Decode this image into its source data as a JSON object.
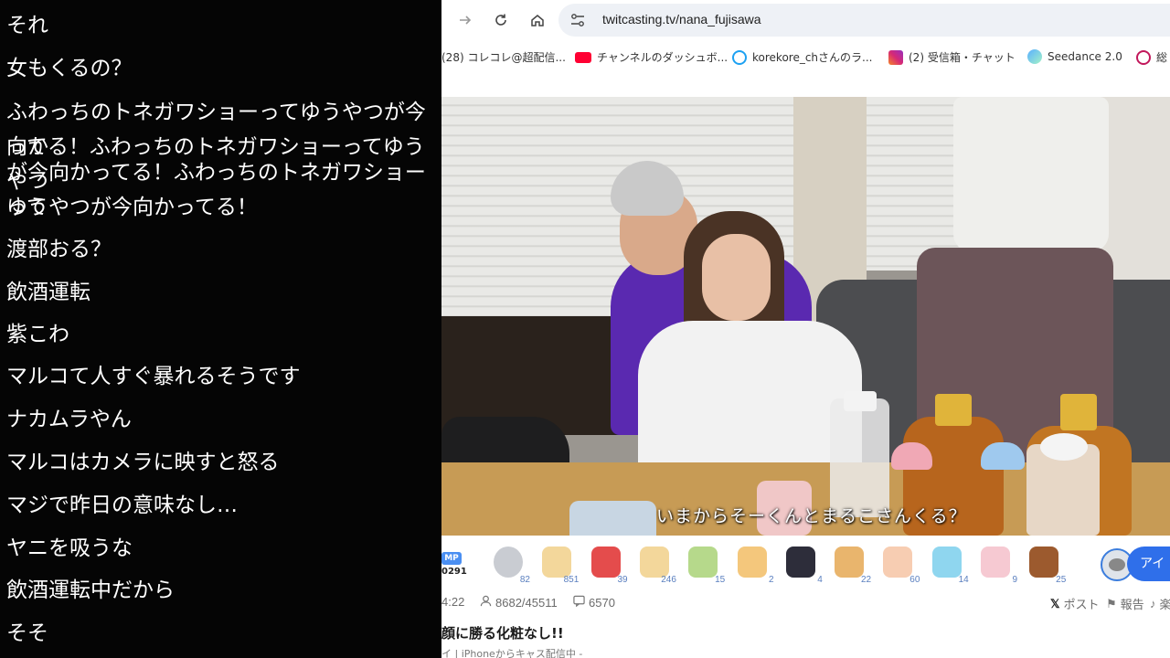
{
  "comments": [
    "それ",
    "女もくるの？",
    "ふわっちのトネガワショーってゆうやつが今向かってる！ふわっちのトネガワショーってゆうやつが今向かってる！ふわっちのトネガワショーってゆうやつが今向かってる！",
    "渡部おる？",
    "飲酒運転",
    "紫こわ",
    "マルコて人すぐ暴れるそうです",
    "ナカムラやん",
    "マルコはカメラに映すと怒る",
    "マジで昨日の意味なし…",
    "ヤニを吸うな",
    "飲酒運転中だから",
    "そそ"
  ],
  "comment_lines": [
    "それ",
    "女もくるの？",
    "ふわっちのトネガワショーってゆうやつが今向か",
    "ってる！ふわっちのトネガワショーってゆうやつ",
    "が今向かってる！ふわっちのトネガワショーって",
    "ゆうやつが今向かってる！",
    "渡部おる？",
    "飲酒運転",
    "紫こわ",
    "マルコて人すぐ暴れるそうです",
    "ナカムラやん",
    "マルコはカメラに映すと怒る",
    "マジで昨日の意味なし…",
    "ヤニを吸うな",
    "飲酒運転中だから",
    "そそ"
  ],
  "browser": {
    "url": "twitcasting.tv/nana_fujisawa",
    "nav": {
      "forward_icon": "arrow-right-icon",
      "reload_icon": "reload-icon",
      "home_icon": "home-icon",
      "site_settings_icon": "tune-icon"
    }
  },
  "bookmarks": [
    {
      "label": "(28) コレコレ@超配信...",
      "icon_color": "#cccccc"
    },
    {
      "label": "チャンネルのダッシュボ...",
      "icon_color": "#ff0033"
    },
    {
      "label": "korekore_chさんのラ...",
      "icon_color": "#1da1f2"
    },
    {
      "label": "(2) 受信箱・チャット",
      "icon_color": "#d62976"
    },
    {
      "label": "Seedance 2.0",
      "icon_color": "#5ab0ff"
    },
    {
      "label": "総",
      "icon_color": "#c2185b"
    }
  ],
  "video": {
    "subtitle": "いまからそーくんとまるこさんくる？"
  },
  "giftbar": {
    "mp_label": "MP",
    "mp_value": "0291",
    "gifts": [
      {
        "name": "coin-gift",
        "count": "82",
        "color": "#c9ccd2"
      },
      {
        "name": "toast-gift",
        "count": "851",
        "color": "#f3d79b"
      },
      {
        "name": "santa-gift",
        "count": "39",
        "color": "#e44c4c"
      },
      {
        "name": "toast-face-gift",
        "count": "246",
        "color": "#f3d79b"
      },
      {
        "name": "toast-green-gift",
        "count": "15",
        "color": "#b6d98b"
      },
      {
        "name": "toast-orange-gift",
        "count": "2",
        "color": "#f4c77c"
      },
      {
        "name": "ninja-gift",
        "count": "4",
        "color": "#2d2d3a"
      },
      {
        "name": "bread-flower-gift",
        "count": "22",
        "color": "#e9b56d"
      },
      {
        "name": "clap-gift",
        "count": "60",
        "color": "#f7cdb2"
      },
      {
        "name": "ghost-gift",
        "count": "14",
        "color": "#8fd6ef"
      },
      {
        "name": "flower-toast-gift",
        "count": "9",
        "color": "#f6c9d2"
      },
      {
        "name": "chestnut-gift",
        "count": "25",
        "color": "#9c5a2e"
      }
    ],
    "action_label": "アイ"
  },
  "stats": {
    "time": "4:22",
    "viewers": "8682/45511",
    "comments": "6570",
    "post_label": "ポスト",
    "report_label": "報告",
    "more_label": "楽"
  },
  "stream": {
    "title": "顔に勝る化粧なし!!",
    "subline": "イ | iPhoneからキャス配信中 -"
  }
}
